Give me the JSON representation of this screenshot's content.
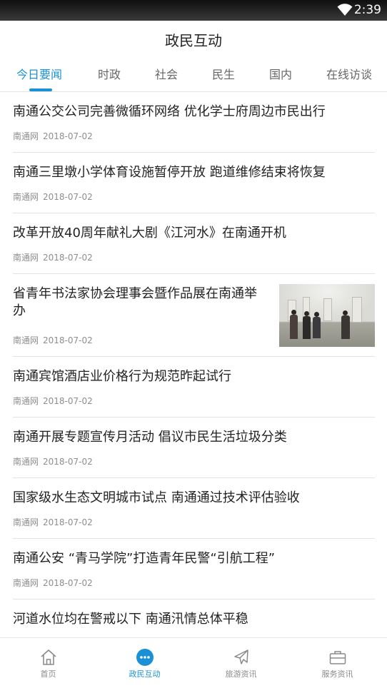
{
  "status_bar": {
    "time": "2:39",
    "wifi_icon": "wifi-icon"
  },
  "header": {
    "title": "政民互动"
  },
  "tabs": [
    {
      "label": "今日要闻",
      "active": true
    },
    {
      "label": "时政",
      "active": false
    },
    {
      "label": "社会",
      "active": false
    },
    {
      "label": "民生",
      "active": false
    },
    {
      "label": "国内",
      "active": false
    },
    {
      "label": "在线访谈",
      "active": false
    }
  ],
  "news": [
    {
      "title": "南通公交公司完善微循环网络 优化学士府周边市民出行",
      "source": "南通网",
      "date": "2018-07-02"
    },
    {
      "title": "南通三里墩小学体育设施暂停开放 跑道维修结束将恢复",
      "source": "南通网",
      "date": "2018-07-02"
    },
    {
      "title": "改革开放40周年献礼大剧《江河水》在南通开机",
      "source": "南通网",
      "date": "2018-07-02"
    },
    {
      "title": "省青年书法家协会理事会暨作品展在南通举办",
      "source": "南通网",
      "date": "2018-07-02",
      "thumbnail": "exhibition-photo"
    },
    {
      "title": "南通宾馆酒店业价格行为规范昨起试行",
      "source": "南通网",
      "date": "2018-07-02"
    },
    {
      "title": "南通开展专题宣传月活动 倡议市民生活垃圾分类",
      "source": "南通网",
      "date": "2018-07-02"
    },
    {
      "title": "国家级水生态文明城市试点 南通通过技术评估验收",
      "source": "南通网",
      "date": "2018-07-02"
    },
    {
      "title": "南通公安 “青马学院”打造青年民警“引航工程”",
      "source": "南通网",
      "date": "2018-07-02"
    },
    {
      "title": "河道水位均在警戒以下 南通汛情总体平稳",
      "source": "",
      "date": ""
    }
  ],
  "bottom_nav": [
    {
      "label": "首页",
      "icon": "home-icon",
      "active": false
    },
    {
      "label": "政民互动",
      "icon": "chat-bubble-icon",
      "active": true
    },
    {
      "label": "旅游资讯",
      "icon": "airplane-icon",
      "active": false
    },
    {
      "label": "服务资讯",
      "icon": "briefcase-icon",
      "active": false
    }
  ],
  "colors": {
    "accent": "#1a91d6",
    "text": "#222222",
    "meta": "#8e8e8e",
    "divider": "#e2e2e2"
  }
}
